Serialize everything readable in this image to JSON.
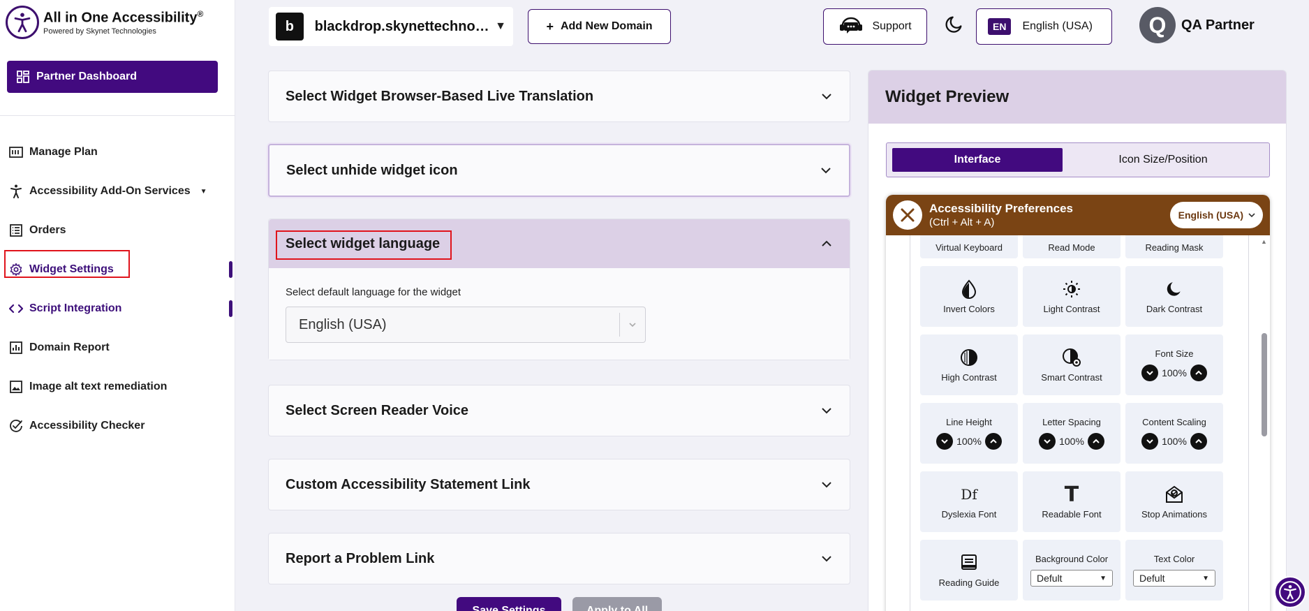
{
  "brand": {
    "title": "All in One Accessibility",
    "reg": "®",
    "subtitle": "Powered by Skynet Technologies"
  },
  "sidebar": {
    "dashboard_label": "Partner Dashboard",
    "items": [
      {
        "label": "Manage Plan",
        "icon": "plan-icon"
      },
      {
        "label": "Accessibility Add-On Services",
        "icon": "accessibility-person-icon"
      },
      {
        "label": "Orders",
        "icon": "orders-list-icon"
      },
      {
        "label": "Widget Settings",
        "icon": "gear-icon"
      },
      {
        "label": "Script Integration",
        "icon": "code-icon"
      },
      {
        "label": "Domain Report",
        "icon": "report-chart-icon"
      },
      {
        "label": "Image alt text remediation",
        "icon": "image-icon"
      },
      {
        "label": "Accessibility Checker",
        "icon": "check-circle-icon"
      }
    ]
  },
  "topbar": {
    "domain_badge": "b",
    "domain_name": "blackdrop.skynettechnologies.us",
    "add_domain_label": "Add New Domain",
    "support_label": "Support",
    "lang_code": "EN",
    "lang_label": "English (USA)",
    "user_initial": "Q",
    "user_name": "QA Partner"
  },
  "accordions": {
    "live_translation": "Select Widget Browser-Based Live Translation",
    "unhide_icon": "Select unhide widget icon",
    "widget_language": {
      "title": "Select widget language",
      "field_label": "Select default language for the widget",
      "selected": "English (USA)"
    },
    "screen_reader": "Select Screen Reader Voice",
    "statement_link": "Custom Accessibility Statement Link",
    "report_problem": "Report a Problem Link"
  },
  "actions": {
    "save_label": "Save Settings",
    "apply_label": "Apply to All"
  },
  "preview": {
    "title": "Widget Preview",
    "tabs": [
      "Interface",
      "Icon Size/Position"
    ],
    "widget": {
      "title": "Accessibility Preferences",
      "shortcut": "(Ctrl + Alt + A)",
      "language": "English (USA)",
      "top_row": [
        "Virtual Keyboard",
        "Read Mode",
        "Reading Mask"
      ],
      "row1": [
        "Invert Colors",
        "Light Contrast",
        "Dark Contrast"
      ],
      "high_contrast": "High Contrast",
      "smart_contrast": "Smart Contrast",
      "font_size": {
        "label": "Font Size",
        "value": "100%"
      },
      "line_height": {
        "label": "Line Height",
        "value": "100%"
      },
      "letter_spacing": {
        "label": "Letter Spacing",
        "value": "100%"
      },
      "content_scaling": {
        "label": "Content Scaling",
        "value": "100%"
      },
      "row4": [
        "Dyslexia Font",
        "Readable Font",
        "Stop Animations"
      ],
      "dyslexia_glyph": "Df",
      "readable_glyph": "T",
      "reading_guide": "Reading Guide",
      "bg_color": {
        "label": "Background Color",
        "value": "Defult"
      },
      "text_color": {
        "label": "Text Color",
        "value": "Defult"
      }
    }
  },
  "colors": {
    "primary": "#420a7f",
    "accent_panel": "#dcd0e6",
    "widget_header": "#7a4414",
    "highlight": "#e0141c"
  }
}
